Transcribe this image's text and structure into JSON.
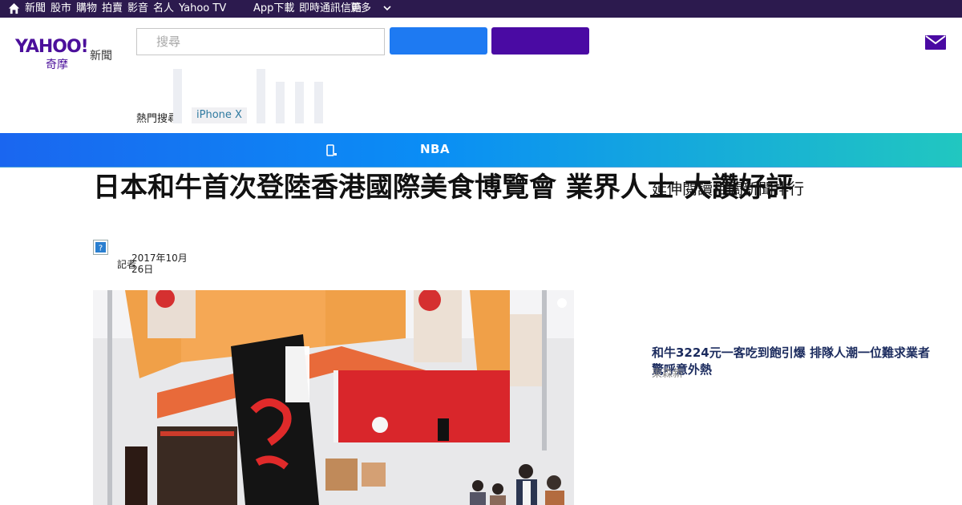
{
  "topbar": {
    "items": [
      "新聞",
      "股市",
      "購物",
      "拍賣",
      "影音",
      "名人",
      "Yahoo TV",
      "App下載",
      "即時通訊信箱",
      "更多"
    ]
  },
  "header": {
    "logo_text": "YAHOO!",
    "logo_sub": "奇摩",
    "logo_section": "新聞",
    "search_placeholder": "搜尋"
  },
  "trending": {
    "label": "熱門搜尋：",
    "chip": "iPhone X"
  },
  "band": {
    "label": "NBA"
  },
  "article": {
    "headline": "日本和牛首次登陸香港國際美食博覽會 業界人士 大讚好評",
    "byline_prefix": "記者",
    "date": "2017年10月26日"
  },
  "sidebar": {
    "title": "延伸閱讀相關新聞排行",
    "link": "和牛3224元一客吃到飽引爆 排隊人潮一位難求業者驚呼意外熱",
    "source": "東森新"
  },
  "colors": {
    "topbar": "#2c1a4e",
    "brand_purple": "#4a0aa3",
    "search_blue": "#1e7af2"
  }
}
